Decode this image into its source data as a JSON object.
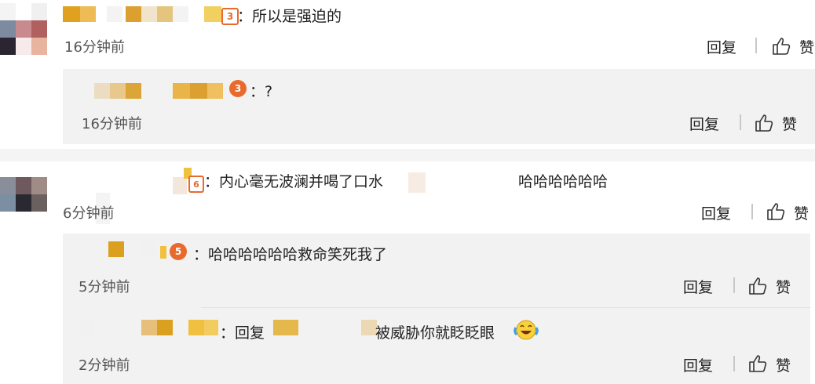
{
  "comments": [
    {
      "text": "：所以是强迫的",
      "time": "16分钟前",
      "reply_label": "回复",
      "like_label": "赞",
      "level_badge": "3",
      "replies": [
        {
          "text": "：?",
          "time": "16分钟前",
          "reply_label": "回复",
          "like_label": "赞",
          "level_badge": "3"
        }
      ]
    },
    {
      "text_part1": "：内心毫无波澜并喝了口水",
      "text_part2": "哈哈哈哈哈哈",
      "time": "6分钟前",
      "reply_label": "回复",
      "like_label": "赞",
      "level_badge": "6",
      "replies": [
        {
          "text": "：哈哈哈哈哈哈救命笑死我了",
          "time": "5分钟前",
          "reply_label": "回复",
          "like_label": "赞",
          "level_badge": "5"
        },
        {
          "text_part1": "：回复",
          "text_part2": "被威胁你就眨眨眼",
          "time": "2分钟前",
          "reply_label": "回复",
          "like_label": "赞",
          "emoji": "laugh-cry-emoji"
        }
      ]
    }
  ],
  "colors": {
    "panel_bg": "#f2f2f2",
    "nickname_mosaic": "#e0a020",
    "level_badge": "#e86a2c",
    "text": "#222222",
    "time": "#555555"
  }
}
